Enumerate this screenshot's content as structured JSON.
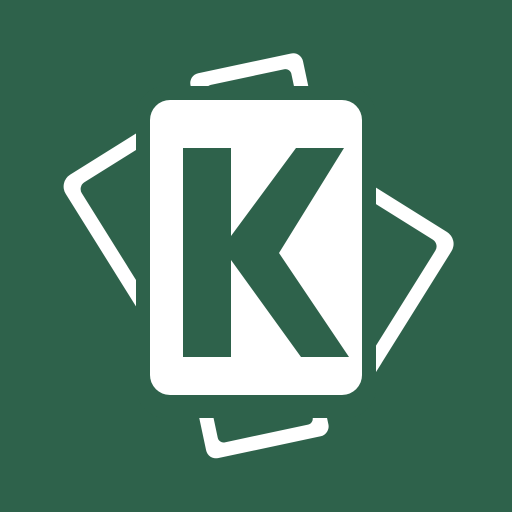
{
  "icon": {
    "name": "cards-k-logo-icon",
    "letter": "K",
    "background_color": "#2e624b",
    "foreground_color": "#ffffff"
  }
}
